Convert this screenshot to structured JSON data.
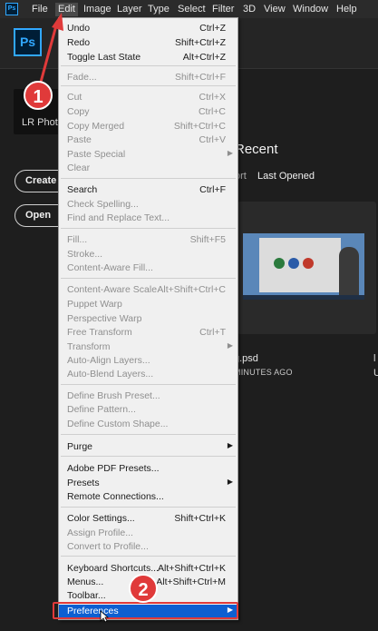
{
  "menubar": {
    "app_icon": "Ps",
    "items": [
      "File",
      "Edit",
      "Image",
      "Layer",
      "Type",
      "Select",
      "Filter",
      "3D",
      "View",
      "Window",
      "Help"
    ],
    "active": "Edit"
  },
  "app": {
    "logo": "Ps"
  },
  "home": {
    "lr_label": "LR Phot",
    "create_label": "Create",
    "open_label": "Open",
    "recent_title": "Recent",
    "sort_label": "ort",
    "last_opened_label": "Last Opened",
    "file_name": "g.psd",
    "file_date": "MINUTES AGO",
    "right_cut_1": "l",
    "right_cut_2": "U"
  },
  "edit_menu": {
    "items": [
      {
        "label": "Undo",
        "shortcut": "Ctrl+Z",
        "disabled": false
      },
      {
        "label": "Redo",
        "shortcut": "Shift+Ctrl+Z",
        "disabled": false
      },
      {
        "label": "Toggle Last State",
        "shortcut": "Alt+Ctrl+Z",
        "disabled": false
      },
      {
        "label": "Fade...",
        "shortcut": "Shift+Ctrl+F",
        "disabled": true
      },
      {
        "label": "Cut",
        "shortcut": "Ctrl+X",
        "disabled": true
      },
      {
        "label": "Copy",
        "shortcut": "Ctrl+C",
        "disabled": true
      },
      {
        "label": "Copy Merged",
        "shortcut": "Shift+Ctrl+C",
        "disabled": true
      },
      {
        "label": "Paste",
        "shortcut": "Ctrl+V",
        "disabled": true
      },
      {
        "label": "Paste Special",
        "shortcut": "",
        "disabled": true,
        "submenu": true
      },
      {
        "label": "Clear",
        "shortcut": "",
        "disabled": true
      },
      {
        "label": "Search",
        "shortcut": "Ctrl+F",
        "disabled": false
      },
      {
        "label": "Check Spelling...",
        "shortcut": "",
        "disabled": true
      },
      {
        "label": "Find and Replace Text...",
        "shortcut": "",
        "disabled": true
      },
      {
        "label": "Fill...",
        "shortcut": "Shift+F5",
        "disabled": true
      },
      {
        "label": "Stroke...",
        "shortcut": "",
        "disabled": true
      },
      {
        "label": "Content-Aware Fill...",
        "shortcut": "",
        "disabled": true
      },
      {
        "label": "Content-Aware Scale",
        "shortcut": "Alt+Shift+Ctrl+C",
        "disabled": true
      },
      {
        "label": "Puppet Warp",
        "shortcut": "",
        "disabled": true
      },
      {
        "label": "Perspective Warp",
        "shortcut": "",
        "disabled": true
      },
      {
        "label": "Free Transform",
        "shortcut": "Ctrl+T",
        "disabled": true
      },
      {
        "label": "Transform",
        "shortcut": "",
        "disabled": true,
        "submenu": true
      },
      {
        "label": "Auto-Align Layers...",
        "shortcut": "",
        "disabled": true
      },
      {
        "label": "Auto-Blend Layers...",
        "shortcut": "",
        "disabled": true
      },
      {
        "label": "Define Brush Preset...",
        "shortcut": "",
        "disabled": true
      },
      {
        "label": "Define Pattern...",
        "shortcut": "",
        "disabled": true
      },
      {
        "label": "Define Custom Shape...",
        "shortcut": "",
        "disabled": true
      },
      {
        "label": "Purge",
        "shortcut": "",
        "disabled": false,
        "submenu": true
      },
      {
        "label": "Adobe PDF Presets...",
        "shortcut": "",
        "disabled": false
      },
      {
        "label": "Presets",
        "shortcut": "",
        "disabled": false,
        "submenu": true
      },
      {
        "label": "Remote Connections...",
        "shortcut": "",
        "disabled": false
      },
      {
        "label": "Color Settings...",
        "shortcut": "Shift+Ctrl+K",
        "disabled": false
      },
      {
        "label": "Assign Profile...",
        "shortcut": "",
        "disabled": true
      },
      {
        "label": "Convert to Profile...",
        "shortcut": "",
        "disabled": true
      },
      {
        "label": "Keyboard Shortcuts...",
        "shortcut": "Alt+Shift+Ctrl+K",
        "disabled": false
      },
      {
        "label": "Menus...",
        "shortcut": "Alt+Shift+Ctrl+M",
        "disabled": false
      },
      {
        "label": "Toolbar...",
        "shortcut": "",
        "disabled": false
      },
      {
        "label": "Preferences",
        "shortcut": "",
        "disabled": false,
        "submenu": true,
        "highlighted": true
      }
    ]
  },
  "annotations": {
    "step1": "1",
    "step2": "2"
  },
  "colors": {
    "accent": "#31a8ff",
    "highlight": "#0d5fd1",
    "annotation": "#e03a3a"
  }
}
